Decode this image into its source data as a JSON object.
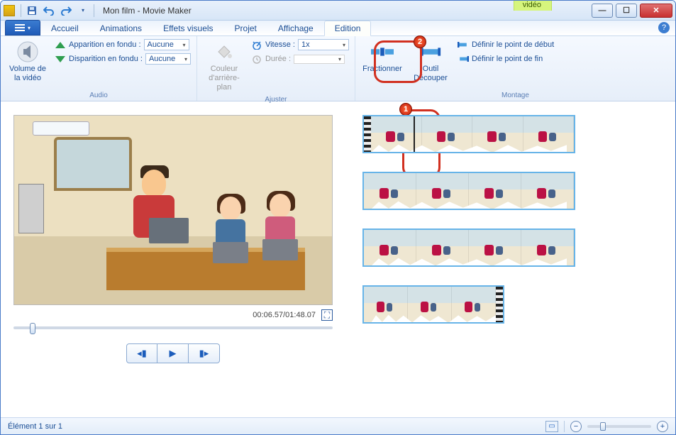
{
  "window": {
    "title": "Mon film - Movie Maker",
    "contextual_tab": "Outils vidéo"
  },
  "tabs": {
    "accueil": "Accueil",
    "animations": "Animations",
    "effets": "Effets visuels",
    "projet": "Projet",
    "affichage": "Affichage",
    "edition": "Edition"
  },
  "ribbon": {
    "audio": {
      "group_label": "Audio",
      "volume": "Volume de la vidéo",
      "apparition": "Apparition en fondu :",
      "disparition": "Disparition en fondu :",
      "apparition_val": "Aucune",
      "disparition_val": "Aucune"
    },
    "ajuster": {
      "group_label": "Ajuster",
      "couleur": "Couleur d'arrière-plan",
      "vitesse": "Vitesse :",
      "vitesse_val": "1x",
      "duree": "Durée :",
      "duree_val": ""
    },
    "montage": {
      "group_label": "Montage",
      "fractionner": "Fractionner",
      "decouper": "Outil Découper",
      "point_debut": "Définir le point de début",
      "point_fin": "Définir le point de fin"
    }
  },
  "preview": {
    "time": "00:06.57/01:48.07"
  },
  "status": {
    "element": "Élément 1 sur 1"
  },
  "annotations": {
    "one": "1",
    "two": "2"
  }
}
